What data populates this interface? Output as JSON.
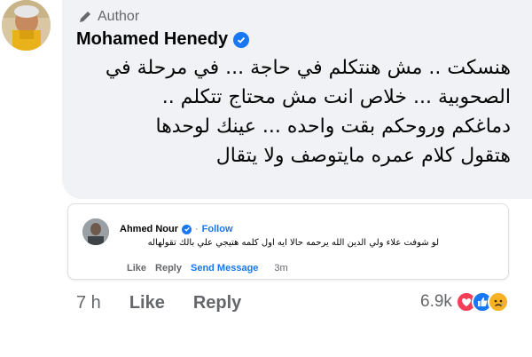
{
  "comment": {
    "author_badge": "Author",
    "author_name": "Mohamed Henedy",
    "text_lines": [
      "هنسكت .. مش هنتكلم في حاجة ... في مرحلة في",
      "الصحوبية ... خلاص انت مش محتاج تتكلم ..",
      "دماغكم وروحكم بقت واحده ... عينك لوحدها",
      "هتقول كلام عمره مايتوصف ولا يتقال"
    ]
  },
  "quoted_comment": {
    "author_name": "Ahmed Nour",
    "follow_label": "Follow",
    "separator": "·",
    "text": "لو شوفت علاء ولي الدين الله يرحمه حالا ايه اول كلمه هتيجي علي بالك تقولهاله",
    "like_label": "Like",
    "reply_label": "Reply",
    "send_message_label": "Send Message",
    "time": "3m"
  },
  "actions": {
    "time": "7 h",
    "like_label": "Like",
    "reply_label": "Reply"
  },
  "reactions": {
    "count": "6.9k",
    "types": [
      "love-reaction-icon",
      "like-reaction-icon",
      "sad-reaction-icon"
    ]
  },
  "colors": {
    "bubble_bg": "#f0f2f5",
    "accent_blue": "#1877f2",
    "secondary_text": "#65676b",
    "love_red": "#f33e58",
    "sad_yellow": "#f7b125"
  }
}
